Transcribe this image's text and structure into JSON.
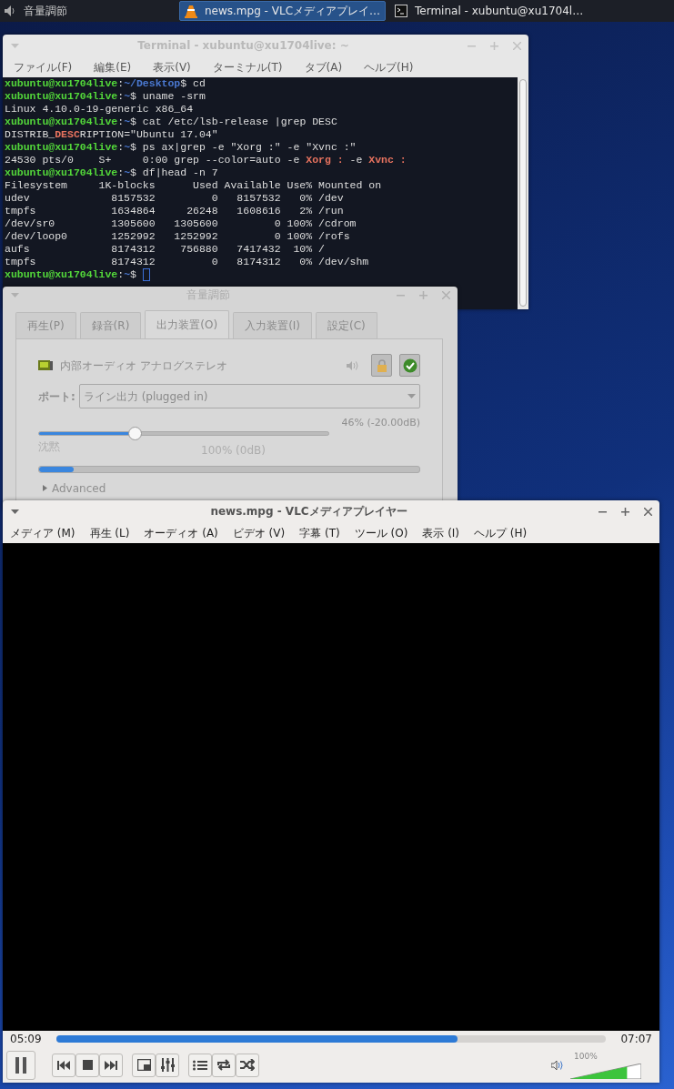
{
  "panel": {
    "launcher": {
      "label": "音量調節"
    },
    "tasks": [
      {
        "label": "news.mpg - VLCメディアプレイ…",
        "kind": "vlc",
        "selected": true
      },
      {
        "label": "Terminal - xubuntu@xu1704l…",
        "kind": "terminal",
        "selected": false
      }
    ]
  },
  "terminal": {
    "title": "Terminal - xubuntu@xu1704live: ~",
    "menu": [
      "ファイル(F)",
      "編集(E)",
      "表示(V)",
      "ターミナル(T)",
      "タブ(A)",
      "ヘルプ(H)"
    ],
    "lines": [
      [
        {
          "kind": "user",
          "text": "xubuntu@xu1704live"
        },
        {
          "kind": "text",
          "text": ":"
        },
        {
          "kind": "path",
          "text": "~/Desktop"
        },
        {
          "kind": "text",
          "text": "$ cd"
        }
      ],
      [
        {
          "kind": "user",
          "text": "xubuntu@xu1704live"
        },
        {
          "kind": "text",
          "text": ":"
        },
        {
          "kind": "path",
          "text": "~"
        },
        {
          "kind": "text",
          "text": "$ uname -srm"
        }
      ],
      [
        {
          "kind": "text",
          "text": "Linux 4.10.0-19-generic x86_64"
        }
      ],
      [
        {
          "kind": "user",
          "text": "xubuntu@xu1704live"
        },
        {
          "kind": "text",
          "text": ":"
        },
        {
          "kind": "path",
          "text": "~"
        },
        {
          "kind": "text",
          "text": "$ cat /etc/lsb-release |grep DESC"
        }
      ],
      [
        {
          "kind": "text",
          "text": "DISTRIB_"
        },
        {
          "kind": "match",
          "text": "DESC"
        },
        {
          "kind": "text",
          "text": "RIPTION=\"Ubuntu 17.04\""
        }
      ],
      [
        {
          "kind": "user",
          "text": "xubuntu@xu1704live"
        },
        {
          "kind": "text",
          "text": ":"
        },
        {
          "kind": "path",
          "text": "~"
        },
        {
          "kind": "text",
          "text": "$ ps ax|grep -e \"Xorg :\" -e \"Xvnc :\""
        }
      ],
      [
        {
          "kind": "text",
          "text": "24530 pts/0    S+     0:00 grep --color=auto -e "
        },
        {
          "kind": "match",
          "text": "Xorg :"
        },
        {
          "kind": "text",
          "text": " -e "
        },
        {
          "kind": "match",
          "text": "Xvnc :"
        }
      ],
      [
        {
          "kind": "user",
          "text": "xubuntu@xu1704live"
        },
        {
          "kind": "text",
          "text": ":"
        },
        {
          "kind": "path",
          "text": "~"
        },
        {
          "kind": "text",
          "text": "$ df|head -n 7"
        }
      ],
      [
        {
          "kind": "text",
          "text": "Filesystem     1K-blocks      Used Available Use% Mounted on"
        }
      ],
      [
        {
          "kind": "text",
          "text": "udev             8157532         0   8157532   0% /dev"
        }
      ],
      [
        {
          "kind": "text",
          "text": "tmpfs            1634864     26248   1608616   2% /run"
        }
      ],
      [
        {
          "kind": "text",
          "text": "/dev/sr0         1305600   1305600         0 100% /cdrom"
        }
      ],
      [
        {
          "kind": "text",
          "text": "/dev/loop0       1252992   1252992         0 100% /rofs"
        }
      ],
      [
        {
          "kind": "text",
          "text": "aufs             8174312    756880   7417432  10% /"
        }
      ],
      [
        {
          "kind": "text",
          "text": "tmpfs            8174312         0   8174312   0% /dev/shm"
        }
      ],
      [
        {
          "kind": "user",
          "text": "xubuntu@xu1704live"
        },
        {
          "kind": "text",
          "text": ":"
        },
        {
          "kind": "path",
          "text": "~"
        },
        {
          "kind": "text",
          "text": "$ "
        }
      ]
    ],
    "cursor": true
  },
  "mixer": {
    "title": "音量調節",
    "tabs": [
      {
        "label": "再生(P)",
        "selected": false
      },
      {
        "label": "録音(R)",
        "selected": false
      },
      {
        "label": "出力装置(O)",
        "selected": true
      },
      {
        "label": "入力装置(I)",
        "selected": false
      },
      {
        "label": "設定(C)",
        "selected": false
      }
    ],
    "device": {
      "name": "内部オーディオ アナログステレオ"
    },
    "port": {
      "label": "ポート:",
      "value": "ライン出力 (plugged in)"
    },
    "slider": {
      "level": 0.33,
      "reading": "46% (-20.00dB)",
      "min_label": "沈黙",
      "mark_label": "100% (0dB)"
    },
    "meter": {
      "level": 0.09
    },
    "advanced": {
      "label": "Advanced",
      "expanded": false
    }
  },
  "vlc": {
    "title": "news.mpg - VLCメディアプレイヤー",
    "menu": [
      "メディア (M)",
      "再生 (L)",
      "オーディオ (A)",
      "ビデオ (V)",
      "字幕 (T)",
      "ツール (O)",
      "表示 (I)",
      "ヘルプ (H)"
    ],
    "elapsed": "05:09",
    "seek": {
      "level": 0.73
    },
    "total": "07:07",
    "control_groups": [
      [
        {
          "kind": "pause"
        }
      ],
      [
        {
          "kind": "previous"
        },
        {
          "kind": "stop"
        },
        {
          "kind": "next"
        }
      ],
      [
        {
          "kind": "fullscreen"
        },
        {
          "kind": "equalizer"
        }
      ],
      [
        {
          "kind": "playlist"
        },
        {
          "kind": "loop"
        },
        {
          "kind": "shuffle"
        }
      ]
    ],
    "volume": {
      "label": "100%",
      "level": 0.8
    }
  }
}
